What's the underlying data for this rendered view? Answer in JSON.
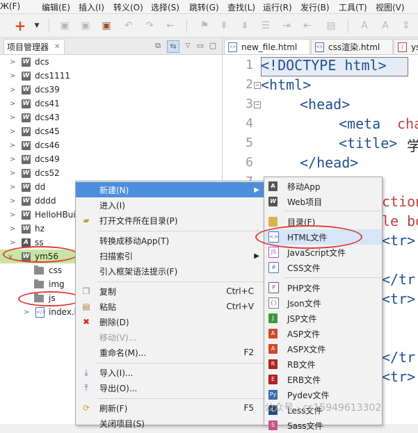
{
  "menubar": [
    "Ж(F)",
    "编辑(E)",
    "插入(I)",
    "转义(O)",
    "选择(S)",
    "跳转(G)",
    "查找(L)",
    "运行(R)",
    "发行(B)",
    "工具(T)",
    "视图(V)"
  ],
  "explorer": {
    "title": "项目管理器",
    "projects": [
      "dcs",
      "dcs1111",
      "dcs39",
      "dcs41",
      "dcs43",
      "dcs45",
      "dcs46",
      "dcs49",
      "dcs52",
      "dd",
      "dddd",
      "HelloHBui",
      "hz",
      "ss",
      "ym56"
    ],
    "children": [
      "css",
      "img",
      "js",
      "index.h"
    ]
  },
  "editor": {
    "tabs": [
      "new_file.html",
      "css渲染.html",
      "ys"
    ],
    "line_numbers": [
      "1",
      "2",
      "3",
      "4",
      "5",
      "6",
      "7"
    ],
    "code": {
      "l1_doctype": "<!DOCTYPE html>",
      "l2": "<html>",
      "l3": "<head>",
      "l4_tag": "<meta",
      "l4_attr": "cha",
      "l5_tag": "<title>",
      "l5_text": "学",
      "l6": "</head>",
      "frag_ction": "ction",
      "frag_le_bo": "le bo",
      "frag_tr1": "<tr>",
      "frag_endtr1": "</tr",
      "frag_tr2": "<tr>",
      "frag_endtr2": "</tr",
      "frag_tr3": "<tr>"
    }
  },
  "context_menu": [
    {
      "label": "新建(N)",
      "shortcut": "",
      "submenu": true
    },
    {
      "label": "进入(I)",
      "shortcut": ""
    },
    {
      "label": "打开文件所在目录(P)",
      "shortcut": ""
    },
    {
      "label": "转换成移动App(T)",
      "shortcut": ""
    },
    {
      "label": "扫描索引",
      "shortcut": "",
      "submenu": true
    },
    {
      "label": "引入框架语法提示(F)",
      "shortcut": ""
    },
    {
      "label": "复制",
      "shortcut": "Ctrl+C"
    },
    {
      "label": "粘贴",
      "shortcut": "Ctrl+V"
    },
    {
      "label": "删除(D)",
      "shortcut": ""
    },
    {
      "label": "移动(V)...",
      "shortcut": ""
    },
    {
      "label": "重命名(M)...",
      "shortcut": "F2"
    },
    {
      "label": "导入(I)...",
      "shortcut": ""
    },
    {
      "label": "导出(O)...",
      "shortcut": ""
    },
    {
      "label": "刷新(F)",
      "shortcut": "F5"
    },
    {
      "label": "关闭项目(S)",
      "shortcut": ""
    }
  ],
  "submenu": [
    "移动App",
    "Web项目",
    "目录(F)",
    "HTML文件",
    "JavaScript文件",
    "CSS文件",
    "PHP文件",
    "Json文件",
    "JSP文件",
    "ASP文件",
    "ASPX文件",
    "RB文件",
    "ERB文件",
    "Pydev文件",
    "Less文件",
    "Sass文件"
  ],
  "watermark": "公众号 · cs15949613302",
  "colors": {
    "selection": "#4c8fdc",
    "annotation": "#e53935",
    "project_selected": "#c8e5a3"
  }
}
